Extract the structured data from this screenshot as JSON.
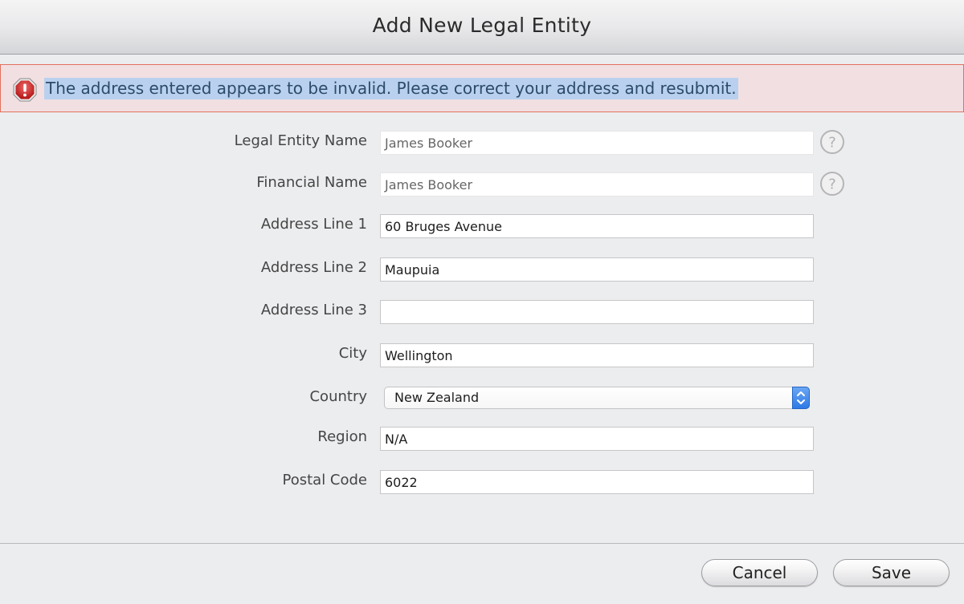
{
  "dialog": {
    "title": "Add New Legal Entity"
  },
  "error": {
    "message": "The address entered appears to be invalid. Please correct your address and resubmit.",
    "icon": "stop-alert-icon",
    "color": "#c81e1e"
  },
  "form": {
    "legal_entity_name": {
      "label": "Legal Entity Name",
      "value": "James Booker"
    },
    "financial_name": {
      "label": "Financial Name",
      "value": "James Booker"
    },
    "address_line_1": {
      "label": "Address Line 1",
      "value": "60 Bruges Avenue"
    },
    "address_line_2": {
      "label": "Address Line 2",
      "value": "Maupuia"
    },
    "address_line_3": {
      "label": "Address Line 3",
      "value": ""
    },
    "city": {
      "label": "City",
      "value": "Wellington"
    },
    "country": {
      "label": "Country",
      "value": "New Zealand"
    },
    "region": {
      "label": "Region",
      "value": "N/A"
    },
    "postal_code": {
      "label": "Postal Code",
      "value": "6022"
    }
  },
  "buttons": {
    "cancel": "Cancel",
    "save": "Save"
  },
  "colors": {
    "error_bg": "#f2dfe2",
    "error_border": "#e2715e",
    "selection_highlight": "#b9d1ee",
    "select_accent": "#2e7ae6"
  }
}
